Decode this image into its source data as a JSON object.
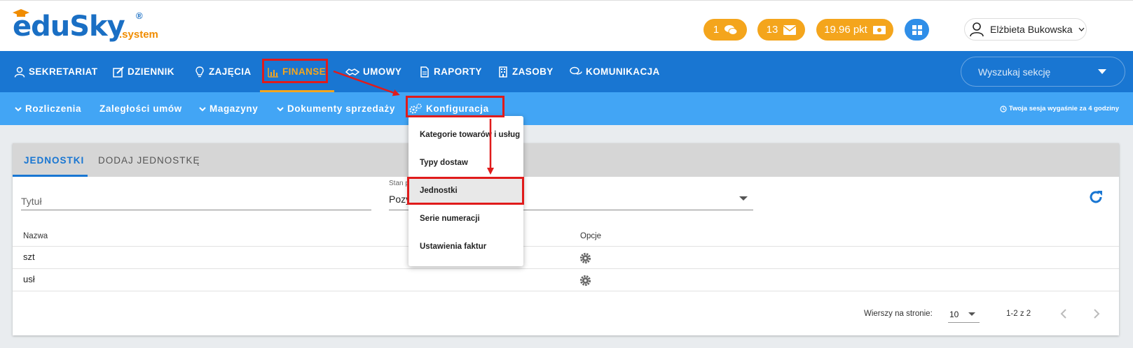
{
  "logo": {
    "main": "eduSky",
    "suffix": ".system",
    "reg": "®"
  },
  "header": {
    "pills": [
      {
        "count": "1",
        "icon": "chat-icon"
      },
      {
        "count": "13",
        "icon": "mail-icon"
      },
      {
        "count": "19.96 pkt",
        "icon": "money-icon"
      }
    ],
    "user_name": "Elżbieta Bukowska"
  },
  "mainnav": {
    "items": [
      {
        "label": "SEKRETARIAT",
        "icon": "user-icon"
      },
      {
        "label": "DZIENNIK",
        "icon": "edit-icon"
      },
      {
        "label": "ZAJĘCIA",
        "icon": "lightbulb-icon"
      },
      {
        "label": "FINANSE",
        "icon": "bar-chart-icon"
      },
      {
        "label": "UMOWY",
        "icon": "handshake-icon"
      },
      {
        "label": "RAPORTY",
        "icon": "document-icon"
      },
      {
        "label": "ZASOBY",
        "icon": "building-icon"
      },
      {
        "label": "KOMUNIKACJA",
        "icon": "chat-icon"
      }
    ],
    "search_placeholder": "Wyszukaj sekcję"
  },
  "subnav": {
    "items": [
      {
        "label": "Rozliczenia"
      },
      {
        "label": "Zaległości umów"
      },
      {
        "label": "Magazyny"
      },
      {
        "label": "Dokumenty sprzedaży"
      },
      {
        "label": "Konfiguracja"
      }
    ],
    "session_text": "Twoja sesja wygaśnie za 4 godziny"
  },
  "dropdown": {
    "items": [
      "Kategorie towarów i usług",
      "Typy dostaw",
      "Jednostki",
      "Serie numeracji",
      "Ustawienia faktur"
    ]
  },
  "card": {
    "tabs": [
      "JEDNOSTKI",
      "DODAJ JEDNOSTKĘ"
    ],
    "title_placeholder": "Tytuł",
    "state_label": "Stan p",
    "state_value": "Pozy",
    "columns": [
      "Nazwa",
      "Opcje"
    ],
    "rows": [
      {
        "name": "szt"
      },
      {
        "name": "usł"
      }
    ],
    "pager": {
      "rows_label": "Wierszy na stronie:",
      "rows_value": "10",
      "range": "1-2 z 2"
    }
  },
  "colors": {
    "primary": "#1976d2",
    "subnav": "#42a5f5",
    "accent": "#f4a51c",
    "annotation": "#e01b1b"
  }
}
